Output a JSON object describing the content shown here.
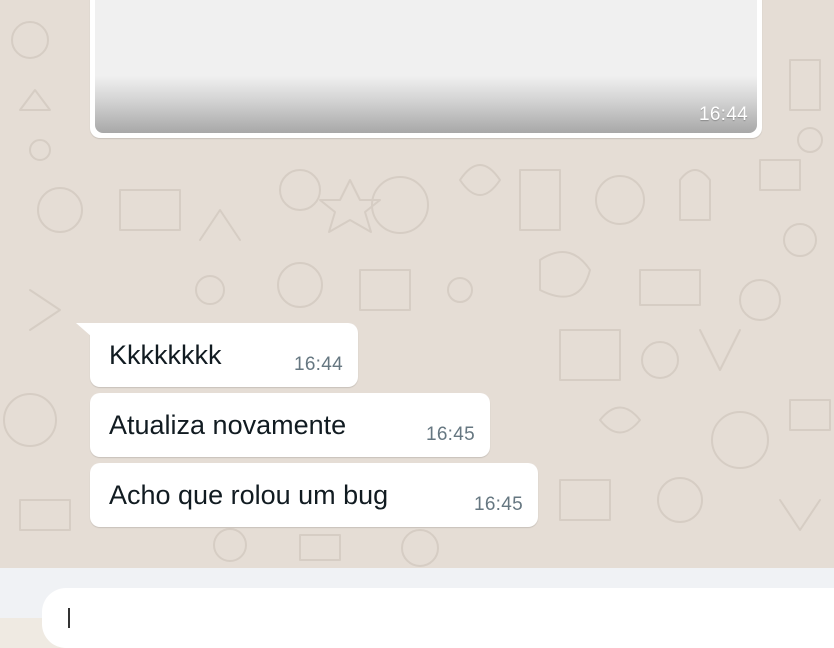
{
  "media_message": {
    "time": "16:44"
  },
  "messages": [
    {
      "text": "Kkkkkkkk",
      "time": "16:44"
    },
    {
      "text": "Atualiza novamente",
      "time": "16:45"
    },
    {
      "text": "Acho que rolou um bug",
      "time": "16:45"
    }
  ],
  "composer": {
    "placeholder": ""
  },
  "colors": {
    "chat_background": "#e5ddd5",
    "bubble": "#ffffff",
    "timestamp": "#667781",
    "composer_bar": "#f0f2f5"
  }
}
